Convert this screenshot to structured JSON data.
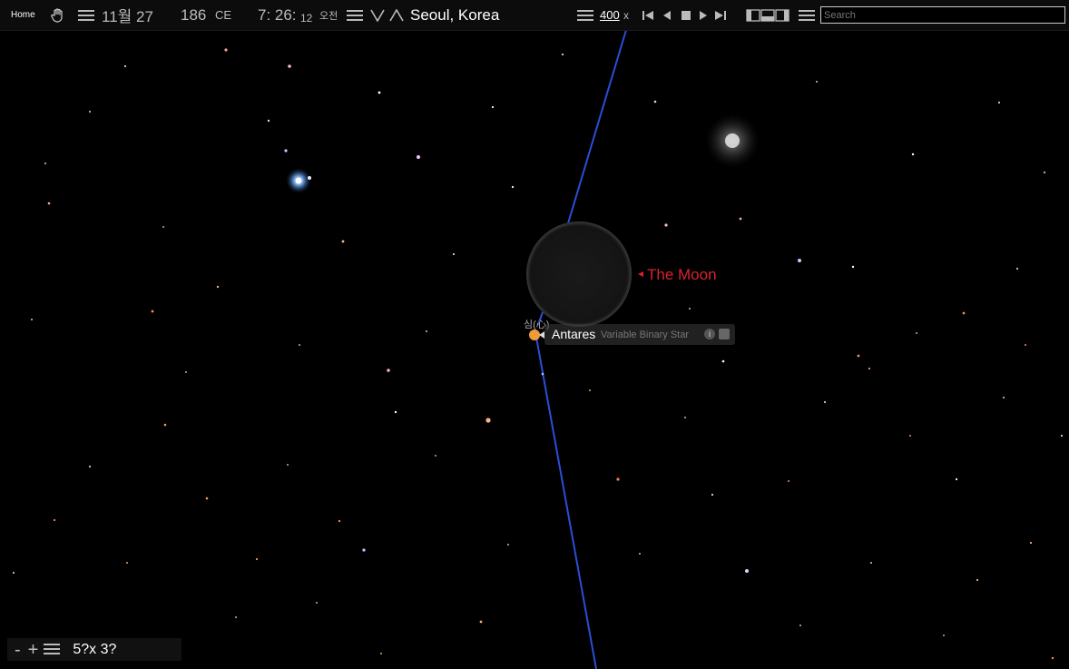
{
  "toolbar": {
    "home_label": "Home",
    "month_day": "11월 27",
    "year": "186",
    "era": "CE",
    "time_hm": "7: 26:",
    "time_s": "12",
    "ampm": "오전",
    "location": "Seoul, Korea",
    "rate": "400",
    "rate_unit": "x"
  },
  "search": {
    "placeholder": "Search"
  },
  "labels": {
    "moon": "The Moon",
    "antares_name": "Antares",
    "antares_type": "Variable Binary Star",
    "antares_info": "i",
    "antares_korean": "심(心)"
  },
  "zoom": {
    "minus": "-",
    "plus": "+",
    "fov": "5?x 3?"
  },
  "colors": {
    "moon_label": "#d9222e",
    "ecliptic_line": "#2a4fd8",
    "antares": "#f09a3a"
  },
  "icons": {
    "hand": "hand-icon",
    "menu": "hamburger-icon",
    "down": "chevron-down-icon",
    "up": "chevron-up-icon"
  }
}
